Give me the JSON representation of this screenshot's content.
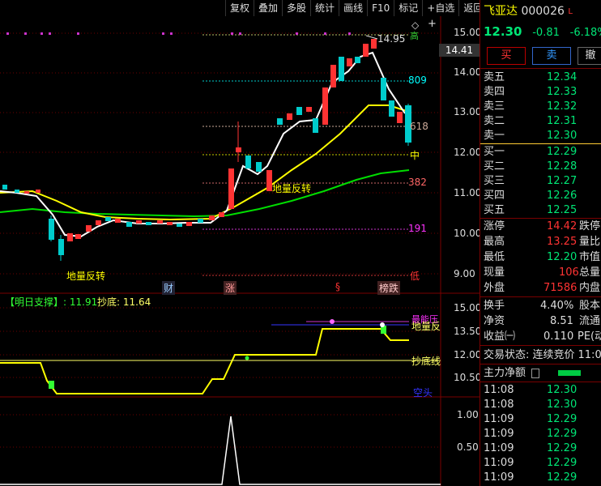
{
  "toolbar": {
    "buttons": [
      "复权",
      "叠加",
      "多股",
      "统计",
      "画线",
      "F10",
      "标记",
      "+自选",
      "返回"
    ]
  },
  "main_chart": {
    "price_axis": [
      "15.00",
      "14.00",
      "13.00",
      "12.00",
      "11.00",
      "10.00",
      "9.00"
    ],
    "current_price_tag": "14.41",
    "high_marker": "14.95",
    "right_labels": {
      "l809": "809",
      "l618": "618",
      "l_mid": "中",
      "l382": "382",
      "l191": "191",
      "l_low": "低",
      "l_top": "高"
    },
    "annotations": {
      "bottom_reversal": "地量反转",
      "upper_reversal": "地量反转"
    },
    "event_tags": [
      "财",
      "涨",
      "§",
      "榜跌"
    ]
  },
  "indicator1": {
    "support_label": "【明日支撑】: 11.91",
    "bottom_label": "抄底: 11.64",
    "axis": [
      "15.00",
      "13.50",
      "12.00",
      "10.50"
    ],
    "right_labels": {
      "strongest": "最能压",
      "reversal": "地量反",
      "bottom_line": "抄底线",
      "empty": "空头"
    }
  },
  "indicator2": {
    "axis": [
      "1.00",
      "0.50"
    ]
  },
  "quote": {
    "name": "飞亚达",
    "code": "000026",
    "flag": "L",
    "price": "12.30",
    "change": "-0.81",
    "change_pct": "-6.18%",
    "buy_label": "买",
    "sell_label": "卖",
    "withdraw_label": "撤",
    "asks": [
      {
        "label": "卖五",
        "price": "12.34"
      },
      {
        "label": "卖四",
        "price": "12.33"
      },
      {
        "label": "卖三",
        "price": "12.32"
      },
      {
        "label": "卖二",
        "price": "12.31"
      },
      {
        "label": "卖一",
        "price": "12.30"
      }
    ],
    "bids": [
      {
        "label": "买一",
        "price": "12.29"
      },
      {
        "label": "买二",
        "price": "12.28"
      },
      {
        "label": "买三",
        "price": "12.27"
      },
      {
        "label": "买四",
        "price": "12.26"
      },
      {
        "label": "买五",
        "price": "12.25"
      }
    ],
    "stats": [
      {
        "l1": "涨停",
        "v1": "14.42",
        "l2": "跌停"
      },
      {
        "l1": "最高",
        "v1": "13.25",
        "l2": "量比"
      },
      {
        "l1": "最低",
        "v1": "12.20",
        "l2": "市值"
      },
      {
        "l1": "现量",
        "v1": "106",
        "l2": "总量"
      },
      {
        "l1": "外盘",
        "v1": "71586",
        "l2": "内盘"
      }
    ],
    "fund": [
      {
        "label": "换手",
        "value": "4.40%",
        "label2": "股本"
      },
      {
        "label": "净资",
        "value": "8.51",
        "label2": "流通"
      },
      {
        "label": "收益㈠",
        "value": "0.110",
        "label2": "PE(动"
      }
    ],
    "trade_status_label": "交易状态: 连续竞价",
    "trade_status_time": "11:0",
    "main_flow_label": "主力净额",
    "ticks": [
      {
        "time": "11:08",
        "price": "12.30"
      },
      {
        "time": "11:08",
        "price": "12.30"
      },
      {
        "time": "11:09",
        "price": "12.29"
      },
      {
        "time": "11:09",
        "price": "12.29"
      },
      {
        "time": "11:09",
        "price": "12.29"
      },
      {
        "time": "11:09",
        "price": "12.29"
      },
      {
        "time": "11:09",
        "price": "12.29"
      }
    ]
  }
}
